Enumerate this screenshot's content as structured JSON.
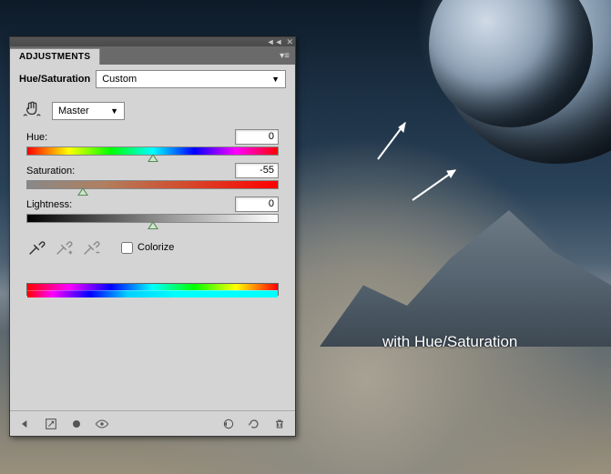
{
  "panel": {
    "tab_label": "ADJUSTMENTS",
    "title": "Hue/Saturation",
    "preset": "Custom",
    "edit": "Master",
    "hue": {
      "label": "Hue:",
      "value": "0",
      "pos": 50
    },
    "sat": {
      "label": "Saturation:",
      "value": "-55",
      "pos": 22
    },
    "light": {
      "label": "Lightness:",
      "value": "0",
      "pos": 50
    },
    "colorize_label": "Colorize",
    "colorize_checked": false
  },
  "caption": "with Hue/Saturation"
}
